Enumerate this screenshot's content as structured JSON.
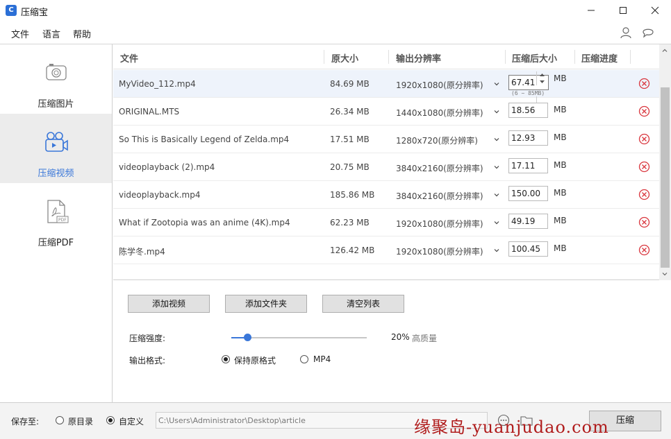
{
  "window": {
    "title": "压缩宝"
  },
  "menu": {
    "file": "文件",
    "language": "语言",
    "help": "帮助"
  },
  "sidebar": {
    "items": [
      {
        "label": "压缩图片",
        "icon": "image-icon"
      },
      {
        "label": "压缩视频",
        "icon": "video-icon",
        "active": true
      },
      {
        "label": "压缩PDF",
        "icon": "pdf-icon"
      }
    ]
  },
  "table": {
    "headers": {
      "file": "文件",
      "orig_size": "原大小",
      "resolution": "输出分辨率",
      "compressed_size": "压缩后大小",
      "progress": "压缩进度"
    },
    "unit": "MB",
    "range_hint": "(6  ~  85MB)",
    "rows": [
      {
        "name": "MyVideo_112.mp4",
        "size": "84.69 MB",
        "resolution": "1920x1080(原分辨率)",
        "target": "67.41"
      },
      {
        "name": "ORIGINAL.MTS",
        "size": "26.34 MB",
        "resolution": "1440x1080(原分辨率)",
        "target": "18.56"
      },
      {
        "name": "So This is Basically Legend of Zelda.mp4",
        "size": "17.51 MB",
        "resolution": "1280x720(原分辨率)",
        "target": "12.93"
      },
      {
        "name": "videoplayback (2).mp4",
        "size": "20.75 MB",
        "resolution": "3840x2160(原分辨率)",
        "target": "17.11"
      },
      {
        "name": "videoplayback.mp4",
        "size": "185.86 MB",
        "resolution": "3840x2160(原分辨率)",
        "target": "150.00"
      },
      {
        "name": "What if Zootopia was an anime (4K).mp4",
        "size": "62.23 MB",
        "resolution": "1920x1080(原分辨率)",
        "target": "49.19"
      },
      {
        "name": "陈学冬.mp4",
        "size": "126.42 MB",
        "resolution": "1920x1080(原分辨率)",
        "target": "100.45"
      }
    ]
  },
  "actions": {
    "add_video": "添加视频",
    "add_folder": "添加文件夹",
    "clear_list": "清空列表"
  },
  "settings": {
    "strength_label": "压缩强度:",
    "strength_value": "20%",
    "strength_fraction": 0.12,
    "strength_desc": "高质量",
    "format_label": "输出格式:",
    "format_keep": "保持原格式",
    "format_mp4": "MP4",
    "format_selected": "keep"
  },
  "save": {
    "label": "保存至:",
    "original_dir": "原目录",
    "custom": "自定义",
    "selected": "custom",
    "path": "C:\\Users\\Administrator\\Desktop\\article"
  },
  "compress_button": "压缩",
  "watermark": "缘聚岛-yuanjudao.com",
  "colors": {
    "accent": "#3a77d9",
    "delete": "#d9363e",
    "selected_row": "#eef3fb"
  }
}
